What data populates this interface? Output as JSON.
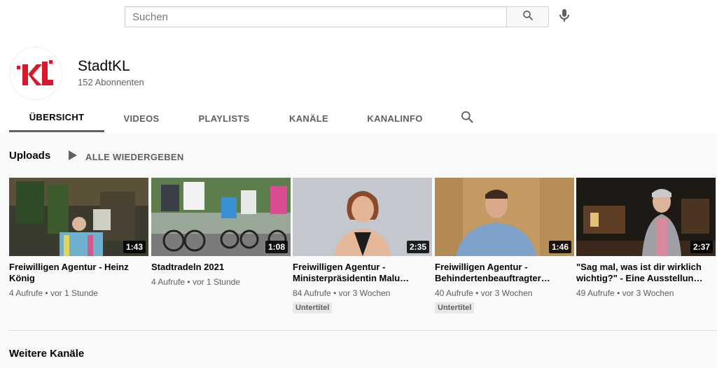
{
  "search": {
    "placeholder": "Suchen",
    "value": ""
  },
  "channel": {
    "name": "StadtKL",
    "subscribers": "152 Abonnenten",
    "avatar_letters": "KL",
    "brand_color": "#d7192e"
  },
  "tabs": [
    {
      "label": "ÜBERSICHT",
      "active": true
    },
    {
      "label": "VIDEOS",
      "active": false
    },
    {
      "label": "PLAYLISTS",
      "active": false
    },
    {
      "label": "KANÄLE",
      "active": false
    },
    {
      "label": "KANALINFO",
      "active": false
    }
  ],
  "shelf": {
    "title": "Uploads",
    "play_all_label": "ALLE WIEDERGEBEN"
  },
  "videos": [
    {
      "title": "Freiwilligen Agentur - Heinz König",
      "duration": "1:43",
      "views": "4 Aufrufe",
      "age": "vor 1 Stunde",
      "badge": ""
    },
    {
      "title": "Stadtradeln 2021",
      "duration": "1:08",
      "views": "4 Aufrufe",
      "age": "vor 1 Stunde",
      "badge": ""
    },
    {
      "title": "Freiwilligen Agentur - Ministerpräsidentin Malu…",
      "duration": "2:35",
      "views": "84 Aufrufe",
      "age": "vor 3 Wochen",
      "badge": "Untertitel"
    },
    {
      "title": "Freiwilligen Agentur - Behindertenbeauftragter…",
      "duration": "1:46",
      "views": "40 Aufrufe",
      "age": "vor 3 Wochen",
      "badge": "Untertitel"
    },
    {
      "title": "\"Sag mal, was ist dir wirklich wichtig?\" - Eine Ausstellun…",
      "duration": "2:37",
      "views": "49 Aufrufe",
      "age": "vor 3 Wochen",
      "badge": ""
    }
  ],
  "meta_separator": "•",
  "more_channels_title": "Weitere Kanäle",
  "icons": {
    "search": "search-icon",
    "mic": "microphone-icon",
    "play": "play-icon",
    "tab_search": "search-icon"
  }
}
